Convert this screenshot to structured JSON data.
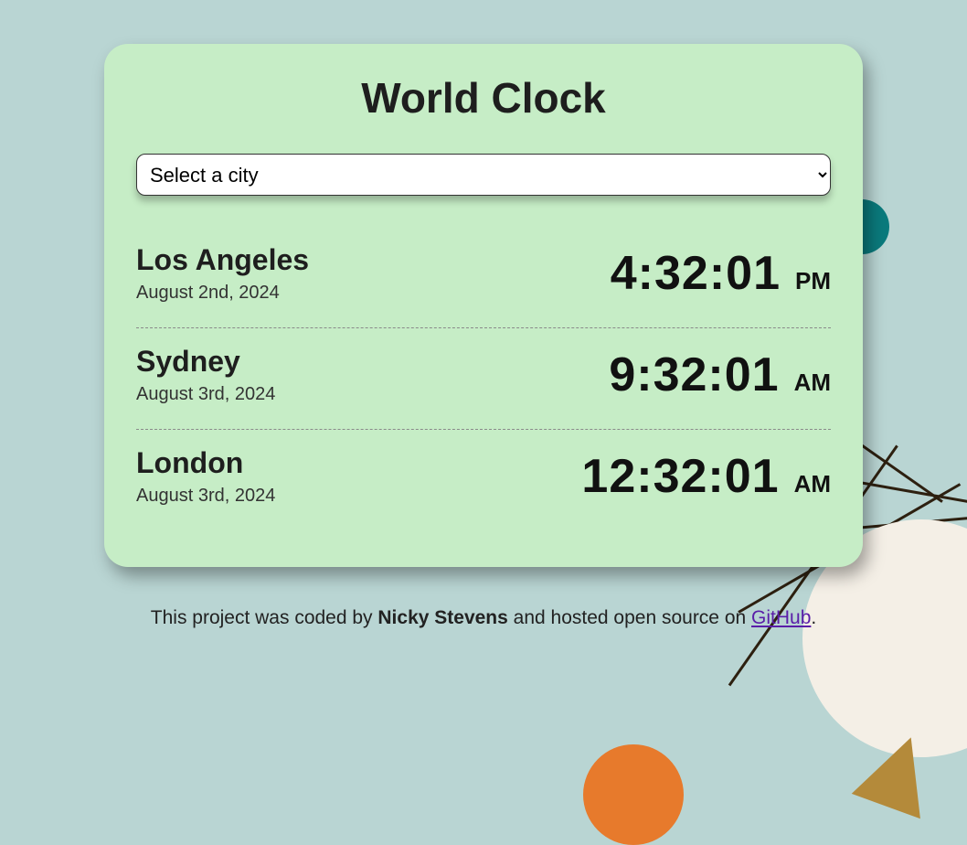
{
  "title": "World Clock",
  "select": {
    "placeholder_option": "Select a city"
  },
  "clocks": [
    {
      "city": "Los Angeles",
      "date": "August 2nd, 2024",
      "time": "4:32:01",
      "meridiem": "PM"
    },
    {
      "city": "Sydney",
      "date": "August 3rd, 2024",
      "time": "9:32:01",
      "meridiem": "AM"
    },
    {
      "city": "London",
      "date": "August 3rd, 2024",
      "time": "12:32:01",
      "meridiem": "AM"
    }
  ],
  "footer": {
    "before": "This project was coded by ",
    "author": "Nicky Stevens",
    "middle": " and hosted open source on ",
    "link_text": "GitHub",
    "after": "."
  }
}
